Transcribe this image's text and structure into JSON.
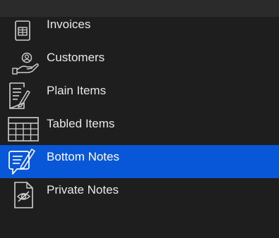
{
  "sidebar": {
    "items": [
      {
        "label": "Invoices",
        "icon": "invoice-icon",
        "selected": false
      },
      {
        "label": "Customers",
        "icon": "customers-icon",
        "selected": false
      },
      {
        "label": "Plain Items",
        "icon": "plain-items-icon",
        "selected": false
      },
      {
        "label": "Tabled Items",
        "icon": "tabled-items-icon",
        "selected": false
      },
      {
        "label": "Bottom Notes",
        "icon": "bottom-notes-icon",
        "selected": true
      },
      {
        "label": "Private Notes",
        "icon": "private-notes-icon",
        "selected": false
      }
    ]
  },
  "colors": {
    "background": "#1e1e1e",
    "top_bar": "#2b2b2b",
    "selection": "#0757d8",
    "text": "#e8e8e8",
    "icon_stroke": "#cfcfcf"
  }
}
